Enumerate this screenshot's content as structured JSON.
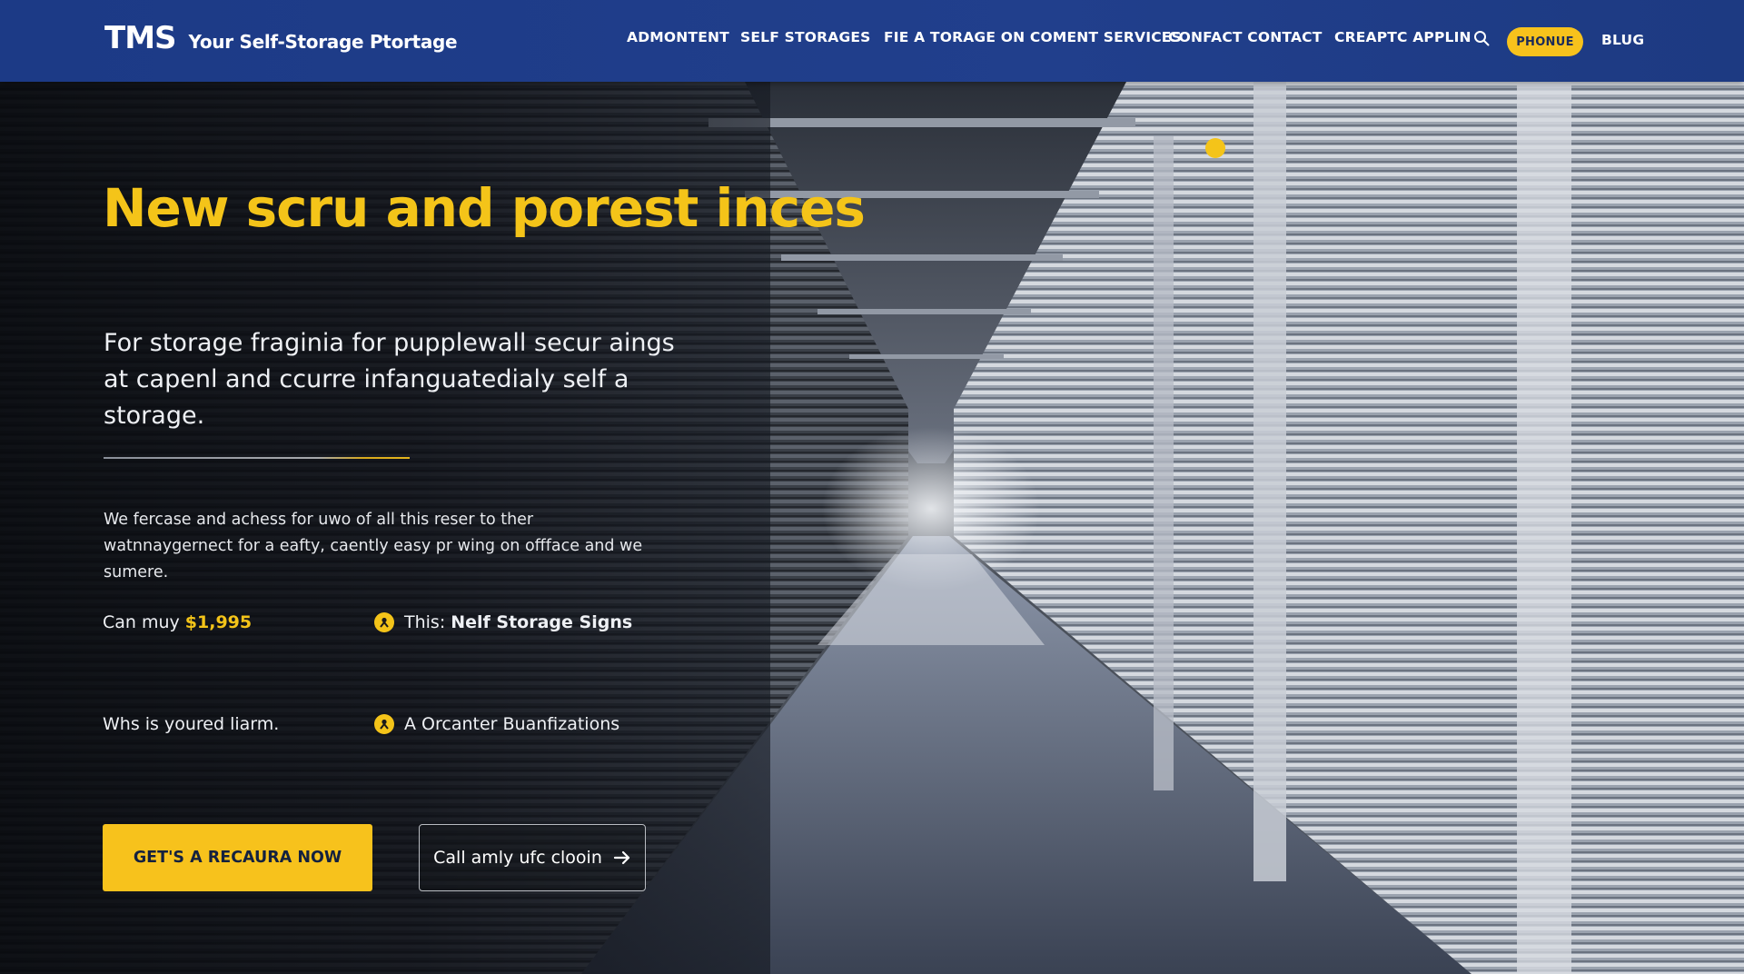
{
  "header": {
    "logo": "TMS",
    "tagline": "Your Self-Storage Ptortage",
    "nav": [
      {
        "label": "ADMONTENT"
      },
      {
        "label": "SELF STORAGES"
      },
      {
        "label": "FIE A TORAGE ON COMENT SERVICES"
      },
      {
        "label": "CONFACT CONTACT"
      },
      {
        "label": "CREAPTC APPLIN"
      }
    ],
    "search_icon": "search-icon",
    "phone_label": "PHONUE",
    "blog_label": "BLUG"
  },
  "hero": {
    "title": "New scru and porest inces",
    "subtitle": "For storage fraginia for pupplewall secur aings at capenl and ccurre infanguatedialy self a storage.",
    "description": "We fercase and achess for uwo of all this reser to ther watnnaygernect for a eafty, caently easy pr wing on offface and we sumere.",
    "features": [
      {
        "prefix": "Can muy",
        "highlight": "$1,995"
      },
      {
        "icon": "badge-icon",
        "prefix": "This:",
        "strong": "Nelf Storage Signs"
      },
      {
        "prefix": "Whs is youred liarm."
      },
      {
        "icon": "badge-icon",
        "prefix": "A Orcanter Buanfizations"
      }
    ],
    "cta_primary": "GET'S A RECAURA NOW",
    "cta_secondary": "Call amly ufc clooin"
  },
  "colors": {
    "header_bg": "#213f8c",
    "accent": "#f4c419",
    "text": "#ffffff"
  }
}
